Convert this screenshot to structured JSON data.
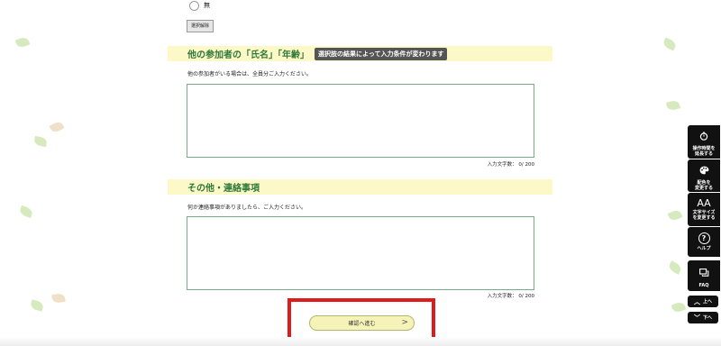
{
  "form": {
    "radio_option_none": "無",
    "clear_selection_label": "選択解除",
    "participants": {
      "title": "他の参加者の「氏名」「年齢」",
      "note": "選択肢の結果によって入力条件が変わります",
      "description": "他の参加者がいる場合は、全員分ご入力ください。",
      "counter": "入力文字数：  0/ 200"
    },
    "other": {
      "title": "その他・連絡事項",
      "description": "何か連絡事項がありましたら、ご入力ください。",
      "counter": "入力文字数：  0/ 200"
    },
    "confirm_label": "確認へ進む",
    "confirm_arrow": ">"
  },
  "side_menu": {
    "extend_time": {
      "icon": "stopwatch-icon",
      "label_line1": "操作時間を",
      "label_line2": "延長する"
    },
    "color": {
      "icon": "palette-icon",
      "label_line1": "配色を",
      "label_line2": "変更する"
    },
    "font_size": {
      "icon": "text-size-icon",
      "icon_text": "AA",
      "label_line1": "文字サイズ",
      "label_line2": "を変更する"
    },
    "help": {
      "icon": "help-icon",
      "icon_text": "?",
      "label": "ヘルプ"
    },
    "faq": {
      "icon": "faq-icon",
      "label": "FAQ"
    },
    "scroll_up": "上へ",
    "scroll_down": "下へ"
  },
  "colors": {
    "accent_green": "#2f7a3a",
    "section_bg": "#fdf8c7",
    "highlight_red": "#e01b1b"
  }
}
